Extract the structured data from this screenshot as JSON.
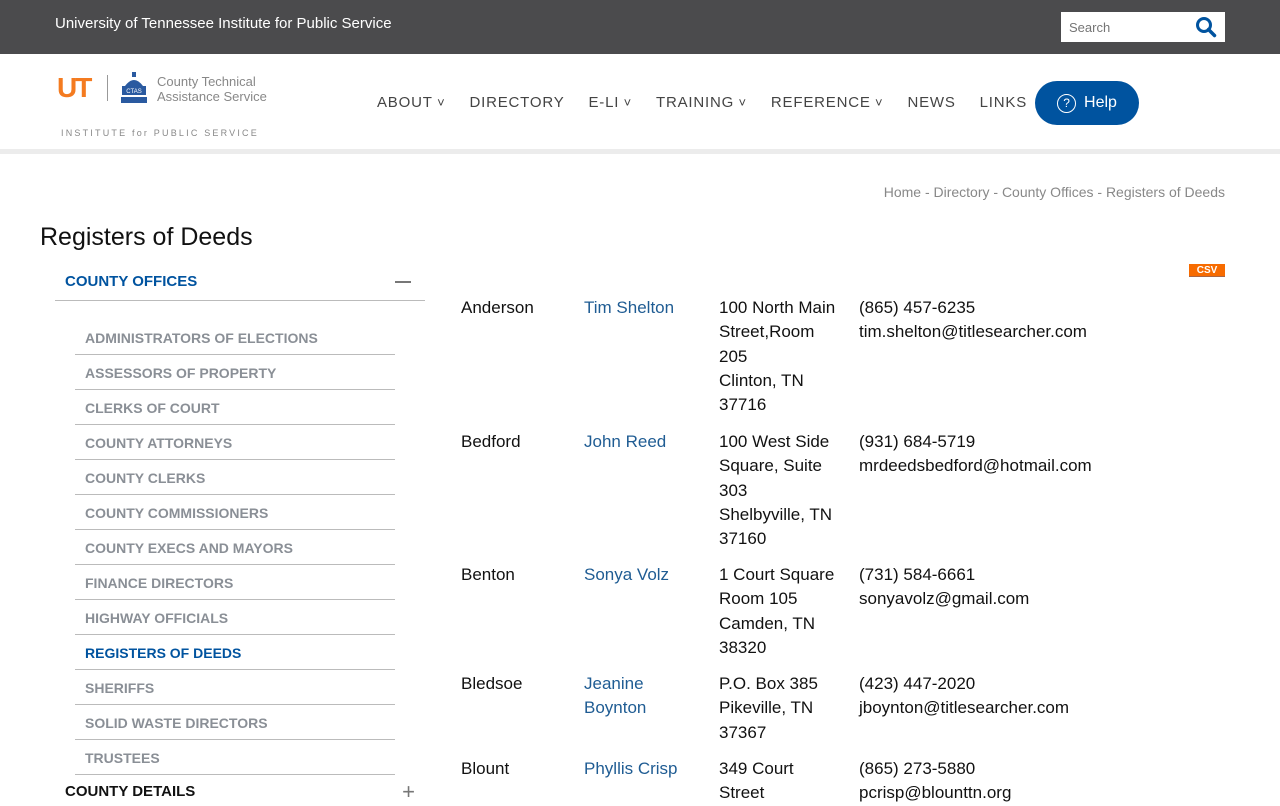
{
  "topbar": {
    "institute": "University of Tennessee Institute for Public Service",
    "search_placeholder": "Search"
  },
  "logo": {
    "ut": "UT",
    "ctas_line1": "County Technical",
    "ctas_line2": "Assistance Service",
    "ctas_seal": "CTAS",
    "institute": "INSTITUTE for PUBLIC SERVICE"
  },
  "nav": {
    "items": [
      {
        "label": "ABOUT",
        "dropdown": true
      },
      {
        "label": "DIRECTORY",
        "dropdown": false
      },
      {
        "label": "E-LI",
        "dropdown": true
      },
      {
        "label": "TRAINING",
        "dropdown": true
      },
      {
        "label": "REFERENCE",
        "dropdown": true
      },
      {
        "label": "NEWS",
        "dropdown": false
      },
      {
        "label": "LINKS",
        "dropdown": false
      }
    ],
    "help": "Help"
  },
  "breadcrumb": "Home - Directory - County Offices - Registers of Deeds",
  "page_title": "Registers of Deeds",
  "sidebar": {
    "section": "COUNTY OFFICES",
    "items": [
      "ADMINISTRATORS OF ELECTIONS",
      "ASSESSORS OF PROPERTY",
      "CLERKS OF COURT",
      "COUNTY ATTORNEYS",
      "COUNTY CLERKS",
      "COUNTY COMMISSIONERS",
      "COUNTY EXECS AND MAYORS",
      "FINANCE DIRECTORS",
      "HIGHWAY OFFICIALS",
      "REGISTERS OF DEEDS",
      "SHERIFFS",
      "SOLID WASTE DIRECTORS",
      "TRUSTEES"
    ],
    "active": "REGISTERS OF DEEDS",
    "next_section": "COUNTY DETAILS"
  },
  "csv": "CSV",
  "colors": {
    "brand_blue": "#00539f",
    "ut_orange": "#f47b20",
    "csv_orange": "#f76b00",
    "topbar": "#4b4b4d"
  },
  "rows": [
    {
      "county": "Anderson",
      "name": "Tim Shelton",
      "address": [
        "100 North Main",
        "Street,Room",
        "205",
        "Clinton, TN",
        "37716"
      ],
      "phone": "(865) 457-6235",
      "email": "tim.shelton@titlesearcher.com"
    },
    {
      "county": "Bedford",
      "name": "John Reed",
      "address": [
        "100 West Side",
        "Square, Suite",
        "303",
        "Shelbyville, TN",
        "37160"
      ],
      "phone": "(931) 684-5719",
      "email": "mrdeedsbedford@hotmail.com"
    },
    {
      "county": "Benton",
      "name": "Sonya Volz",
      "address": [
        "1 Court Square",
        "Room 105",
        "Camden, TN",
        "38320"
      ],
      "phone": "(731) 584-6661",
      "email": "sonyavolz@gmail.com"
    },
    {
      "county": "Bledsoe",
      "name": "Jeanine Boynton",
      "address": [
        "P.O. Box 385",
        "Pikeville, TN",
        "37367"
      ],
      "phone": "(423) 447-2020",
      "email": "jboynton@titlesearcher.com"
    },
    {
      "county": "Blount",
      "name": "Phyllis Crisp",
      "address": [
        "349 Court",
        "Street"
      ],
      "phone": "(865) 273-5880",
      "email": "pcrisp@blounttn.org"
    }
  ]
}
